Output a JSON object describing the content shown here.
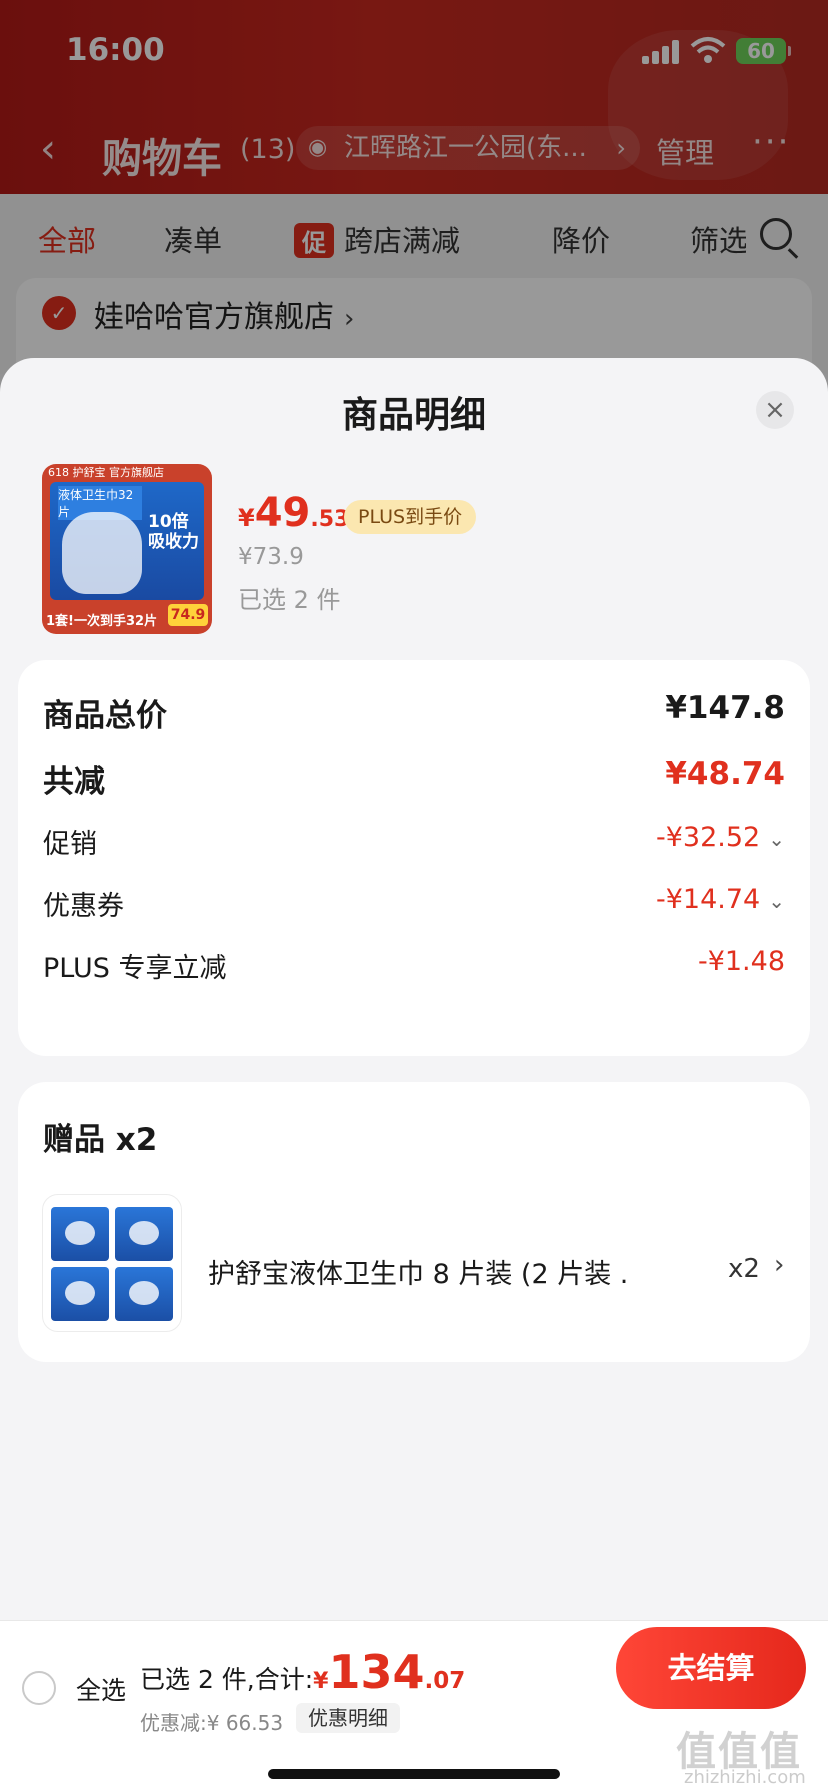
{
  "status_bar": {
    "time": "16:00",
    "battery": "60"
  },
  "nav": {
    "back_glyph": "‹",
    "title": "购物车",
    "count": "(13)",
    "address": "江晖路江一公园(东...",
    "manage": "管理",
    "more_glyph": "···"
  },
  "filter_tabs": [
    {
      "label": "全部",
      "active": true
    },
    {
      "label": "凑单"
    },
    {
      "promo_tag": "促",
      "label": "跨店满减"
    },
    {
      "label": "降价"
    },
    {
      "label": "筛选"
    }
  ],
  "shop": {
    "name": "娃哈哈官方旗舰店"
  },
  "sheet": {
    "title": "商品明细",
    "close_glyph": "×",
    "product": {
      "image_labels": {
        "tag": "618 护舒宝 官方旗舰店",
        "name": "液体卫生巾32片",
        "feature": "10倍吸收力",
        "bottom": "1套!一次到手32片",
        "flag": "74.9"
      },
      "price_currency": "¥",
      "price_integer": "49",
      "price_decimal": ".53",
      "plus_badge": "PLUS到手价",
      "original_price": "¥73.9",
      "selected": "已选 2 件"
    },
    "summary": {
      "total_label": "商品总价",
      "total_value": "¥147.8",
      "discount_label": "共减",
      "discount_value": "¥48.74",
      "rows": [
        {
          "label": "促销",
          "value": "-¥32.52",
          "has_chevron": true
        },
        {
          "label": "优惠券",
          "value": "-¥14.74",
          "has_chevron": true
        },
        {
          "label": "PLUS 专享立减",
          "value": "-¥1.48",
          "has_chevron": false
        }
      ]
    },
    "gift": {
      "title": "赠品 x2",
      "name": "护舒宝液体卫生巾 8 片装 (2 片装 ...",
      "qty": "x2"
    }
  },
  "checkout": {
    "select_all": "全选",
    "selected_total_label": "已选 2 件,合计:",
    "currency": "¥",
    "total_integer": "134",
    "total_decimal": ".07",
    "discount_text": "优惠减:¥ 66.53",
    "detail_link": "优惠明细",
    "button": "去结算"
  },
  "watermark": {
    "main": "值值值",
    "sub": "zhizhizhi.com"
  },
  "colors": {
    "accent": "#e0301e",
    "header_red": "#b21a17",
    "plus_badge_bg": "#fbe7b0"
  }
}
